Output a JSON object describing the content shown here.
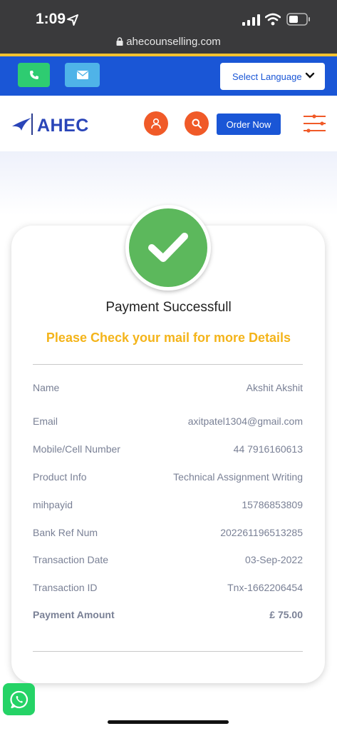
{
  "status_bar": {
    "time": "1:09",
    "battery_icon": "battery-icon",
    "wifi_icon": "wifi-icon",
    "signal_icon": "signal-icon"
  },
  "browser": {
    "url": "ahecounselling.com"
  },
  "topbar": {
    "language_label": "Select Language",
    "bg_color": "#1a56d6",
    "phone_icon": "phone-icon",
    "mail_icon": "mail-icon"
  },
  "header": {
    "logo_text": "AHEC",
    "order_label": "Order Now",
    "user_icon": "user-icon",
    "search_icon": "search-icon",
    "menu_icon": "filter-menu-icon"
  },
  "payment": {
    "status": "Payment Successfull",
    "message": "Please Check your mail for more Details",
    "accent_color": "#f4b41a",
    "success_color": "#5cb85c",
    "details": [
      {
        "label": "Name",
        "value": "Akshit Akshit"
      },
      {
        "label": "Email",
        "value": "axitpatel1304@gmail.com"
      },
      {
        "label": "Mobile/Cell Number",
        "value": "44 7916160613"
      },
      {
        "label": "Product Info",
        "value": "Technical Assignment Writing"
      },
      {
        "label": "mihpayid",
        "value": "15786853809"
      },
      {
        "label": "Bank Ref Num",
        "value": "202261196513285"
      },
      {
        "label": "Transaction Date",
        "value": "03-Sep-2022"
      },
      {
        "label": "Transaction ID",
        "value": "Tnx-1662206454"
      },
      {
        "label": "Payment Amount",
        "value": "£ 75.00"
      }
    ]
  },
  "floating": {
    "whatsapp_icon": "whatsapp-icon"
  }
}
